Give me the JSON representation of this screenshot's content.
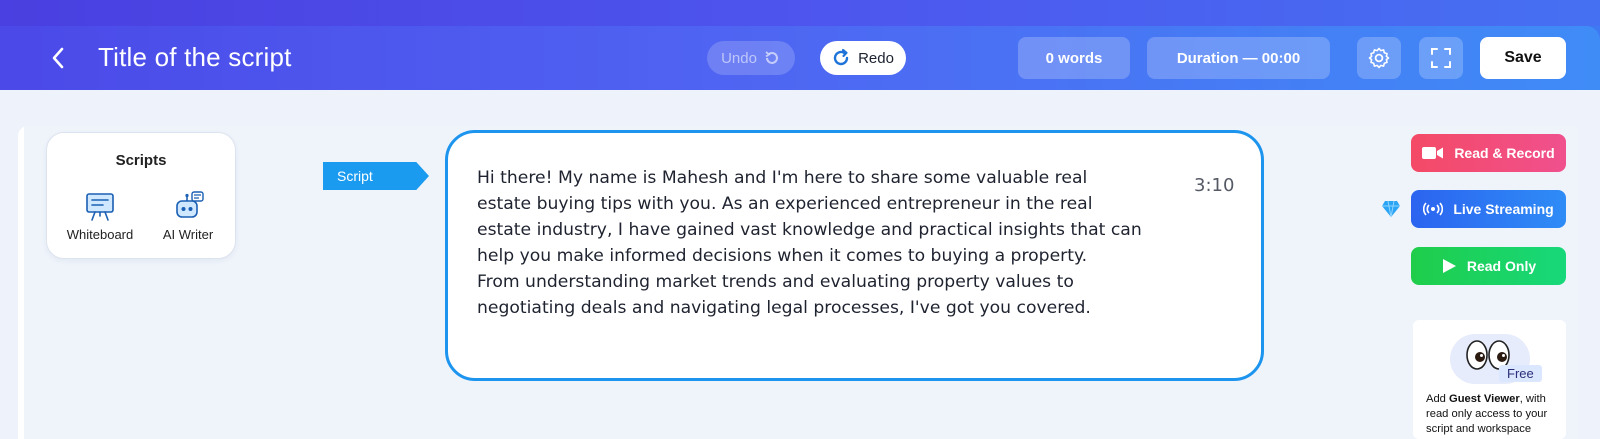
{
  "header": {
    "title": "Title of the script",
    "undo_label": "Undo",
    "redo_label": "Redo",
    "words": "0 words",
    "duration": "Duration — 00:00",
    "save_label": "Save"
  },
  "sidebar": {
    "title": "Scripts",
    "tools": [
      {
        "label": "Whiteboard",
        "icon": "whiteboard-icon"
      },
      {
        "label": "AI Writer",
        "icon": "robot-icon"
      }
    ]
  },
  "editor": {
    "tag": "Script",
    "lines": [
      "Hi there! My name is Mahesh and I'm here to share some valuable real",
      "estate buying tips with you. As an experienced entrepreneur in the real",
      "estate industry, I have gained vast knowledge and practical insights that can",
      "help you make informed decisions when it comes to buying a property.",
      "From understanding market trends and evaluating property values to",
      "negotiating deals and navigating legal processes, I've got you covered."
    ],
    "time": "3:10"
  },
  "actions": {
    "read_record": "Read & Record",
    "live_streaming": "Live Streaming",
    "read_only": "Read Only"
  },
  "guest": {
    "badge": "Free",
    "text_before": "Add ",
    "text_bold": "Guest Viewer",
    "text_after": ", with read only access to your script and workspace"
  },
  "colors": {
    "header_start": "#4b49e8",
    "header_end": "#3f8cf7",
    "editor_border": "#1d95ee",
    "read_record": "#f44a67",
    "live_streaming": "#2c64f0",
    "read_only": "#1fcd4a"
  }
}
